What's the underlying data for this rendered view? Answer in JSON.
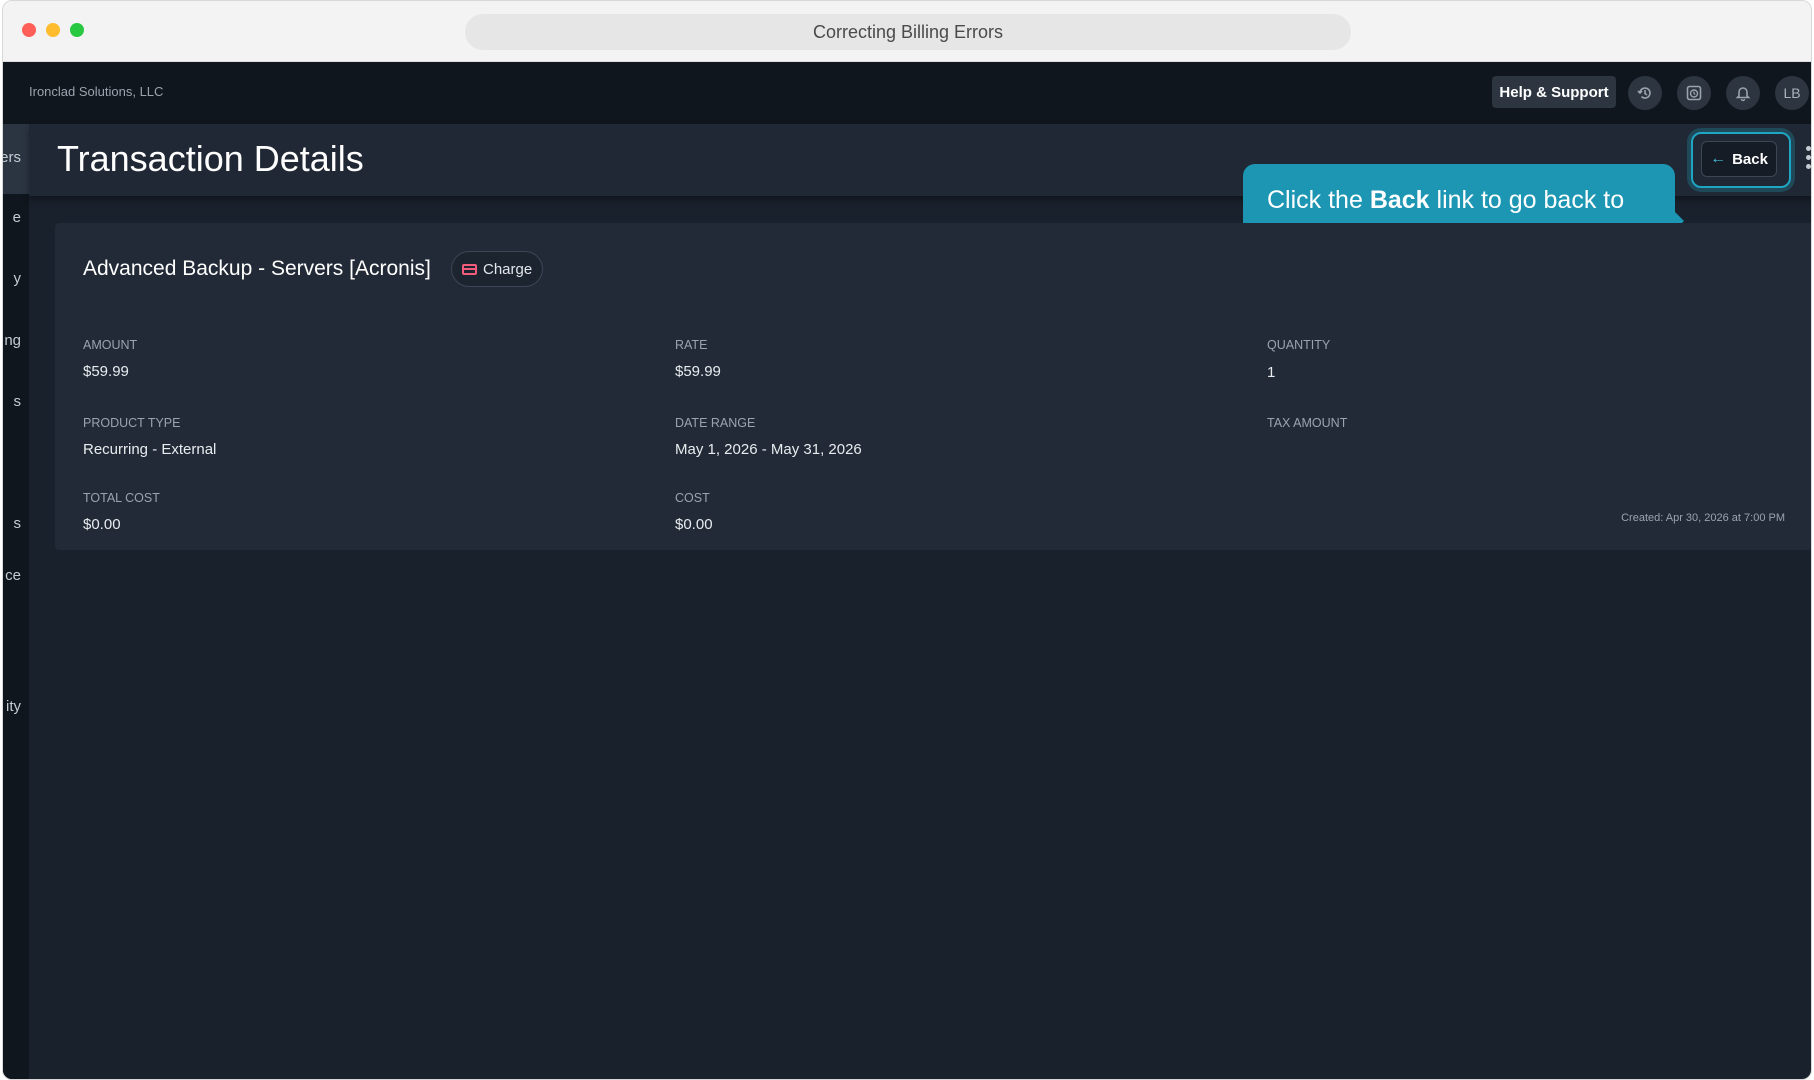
{
  "window": {
    "title": "Correcting Billing Errors"
  },
  "topbar": {
    "org_name": "Ironclad Solutions, LLC",
    "help_label": "Help & Support",
    "avatar_initials": "LB",
    "icons": [
      "history-icon",
      "timer-icon",
      "bell-icon"
    ]
  },
  "sidebar": {
    "items": [
      "ers",
      "e",
      "y",
      "ng",
      "s",
      "s",
      "ce",
      "ity"
    ]
  },
  "page": {
    "title": "Transaction Details",
    "back_label": "Back"
  },
  "tooltip": {
    "prefix": "Click the ",
    "bold": "Back",
    "suffix": " link to go back to the list."
  },
  "transaction": {
    "name": "Advanced Backup - Servers [Acronis]",
    "type_badge": "Charge",
    "fields": {
      "amount_label": "AMOUNT",
      "amount_value": "$59.99",
      "rate_label": "RATE",
      "rate_value": "$59.99",
      "quantity_label": "QUANTITY",
      "quantity_value": "1",
      "product_type_label": "PRODUCT TYPE",
      "product_type_value": "Recurring - External",
      "date_range_label": "DATE RANGE",
      "date_range_value": "May 1, 2026 - May 31, 2026",
      "tax_amount_label": "TAX AMOUNT",
      "tax_amount_value": "",
      "total_cost_label": "TOTAL COST",
      "total_cost_value": "$0.00",
      "cost_label": "COST",
      "cost_value": "$0.00"
    },
    "created": "Created: Apr 30, 2026 at 7:00 PM"
  },
  "colors": {
    "accent": "#1c96b3",
    "background": "#19212c",
    "card": "#212a36",
    "charge_icon": "#f25c7a"
  }
}
